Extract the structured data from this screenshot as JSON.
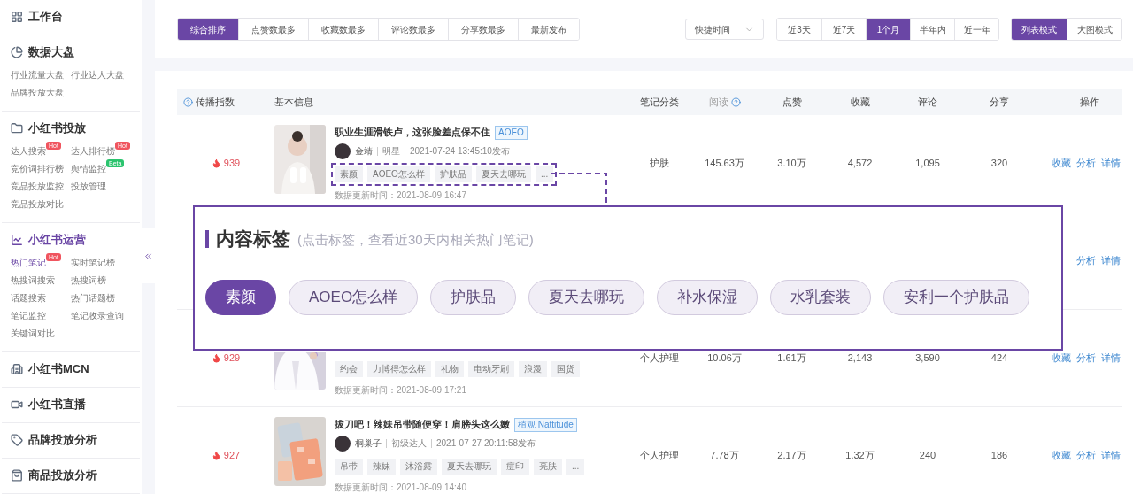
{
  "sidebar": {
    "sections": [
      {
        "title": "工作台",
        "selected": false
      },
      {
        "title": "数据大盘",
        "selected": false,
        "items": [
          {
            "label": "行业流量大盘",
            "selected": false
          },
          {
            "label": "行业达人大盘",
            "selected": false
          },
          {
            "label": "品牌投放大盘",
            "selected": false
          }
        ]
      },
      {
        "title": "小红书投放",
        "selected": false,
        "items": [
          {
            "label": "达人搜索",
            "selected": false,
            "badge": {
              "text": "Hot",
              "color": "#f0555f"
            }
          },
          {
            "label": "达人排行榜",
            "selected": false,
            "badge": {
              "text": "Hot",
              "color": "#f0555f"
            }
          },
          {
            "label": "竞价词排行榜",
            "selected": false
          },
          {
            "label": "舆情监控",
            "selected": false,
            "badge": {
              "text": "Beta",
              "color": "#2bc46e"
            }
          },
          {
            "label": "竞品投放监控",
            "selected": false
          },
          {
            "label": "投放管理",
            "selected": false
          },
          {
            "label": "竞品投放对比",
            "selected": false
          }
        ]
      },
      {
        "title": "小红书运营",
        "selected": true,
        "items": [
          {
            "label": "热门笔记",
            "selected": true,
            "badge": {
              "text": "Hot",
              "color": "#f0555f"
            }
          },
          {
            "label": "实时笔记榜",
            "selected": false
          },
          {
            "label": "热搜词搜索",
            "selected": false
          },
          {
            "label": "热搜词榜",
            "selected": false
          },
          {
            "label": "话题搜索",
            "selected": false
          },
          {
            "label": "热门话题榜",
            "selected": false
          },
          {
            "label": "笔记监控",
            "selected": false
          },
          {
            "label": "笔记收录查询",
            "selected": false
          },
          {
            "label": "关键词对比",
            "selected": false
          }
        ]
      },
      {
        "title": "小红书MCN",
        "selected": false
      },
      {
        "title": "小红书直播",
        "selected": false
      },
      {
        "title": "品牌投放分析",
        "selected": false
      },
      {
        "title": "商品投放分析",
        "selected": false
      }
    ]
  },
  "sort_tabs": [
    {
      "label": "综合排序",
      "selected": true
    },
    {
      "label": "点赞数最多",
      "selected": false
    },
    {
      "label": "收藏数最多",
      "selected": false
    },
    {
      "label": "评论数最多",
      "selected": false
    },
    {
      "label": "分享数最多",
      "selected": false
    },
    {
      "label": "最新发布",
      "selected": false
    }
  ],
  "time_select": {
    "placeholder": "快捷时间"
  },
  "period_tabs": [
    {
      "label": "近3天",
      "selected": false
    },
    {
      "label": "近7天",
      "selected": false
    },
    {
      "label": "1个月",
      "selected": true
    },
    {
      "label": "半年内",
      "selected": false
    },
    {
      "label": "近一年",
      "selected": false
    }
  ],
  "view_tabs": [
    {
      "label": "列表模式",
      "selected": true
    },
    {
      "label": "大图模式",
      "selected": false
    }
  ],
  "table": {
    "columns": [
      {
        "label": "传播指数",
        "help": true,
        "muted": false
      },
      {
        "label": "基本信息",
        "help": false,
        "muted": false
      },
      {
        "label": "笔记分类",
        "help": false,
        "muted": false
      },
      {
        "label": "阅读",
        "help": true,
        "muted": true
      },
      {
        "label": "点赞",
        "help": false,
        "muted": false
      },
      {
        "label": "收藏",
        "help": false,
        "muted": false
      },
      {
        "label": "评论",
        "help": false,
        "muted": false
      },
      {
        "label": "分享",
        "help": false,
        "muted": false
      },
      {
        "label": "操作",
        "help": false,
        "muted": false
      }
    ],
    "rows": [
      {
        "score": "939",
        "thumbnail": {
          "kind": "picture"
        },
        "title": "职业生涯滑铁卢，这张脸差点保不住",
        "brand": "AOEO",
        "author": "金靖",
        "role": "明星",
        "date": "2021-07-24 13:45:10发布",
        "tags_highlighted": true,
        "tags": [
          "素颜",
          "AOEO怎么样",
          "护肤品",
          "夏天去哪玩",
          "..."
        ],
        "updated": "数据更新时间：2021-08-09 16:47",
        "category": "护肤",
        "stats": [
          "145.63万",
          "3.10万",
          "4,572",
          "1,095",
          "320"
        ],
        "actions": [
          "收藏",
          "分析",
          "详情"
        ]
      },
      {
        "tags": [],
        "stats": [],
        "actions": [
          "分析",
          "详情"
        ]
      },
      {
        "score": "929",
        "thumbnail": {
          "kind": "picture"
        },
        "tags_highlighted": false,
        "tags": [
          "约会",
          "力博得怎么样",
          "礼物",
          "电动牙刷",
          "浪漫",
          "国货"
        ],
        "updated": "数据更新时间：2021-08-09 17:21",
        "category": "个人护理",
        "stats": [
          "10.06万",
          "1.61万",
          "2,143",
          "3,590",
          "424"
        ],
        "actions": [
          "收藏",
          "分析",
          "详情"
        ]
      },
      {
        "score": "927",
        "thumbnail": {
          "kind": "picture"
        },
        "title": "拔刀吧！辣妹吊带随便穿！肩膀头这么嫩",
        "brand": "植观 Nattitude",
        "author": "桐巢子",
        "role": "初级达人",
        "date": "2021-07-27 20:11:58发布",
        "tags_highlighted": false,
        "tags": [
          "吊带",
          "辣妹",
          "沐浴露",
          "夏天去哪玩",
          "痘印",
          "亮肤",
          "..."
        ],
        "updated": "数据更新时间：2021-08-09 14:40",
        "category": "个人护理",
        "stats": [
          "7.78万",
          "2.17万",
          "1.32万",
          "240",
          "186"
        ],
        "actions": [
          "收藏",
          "分析",
          "详情"
        ]
      }
    ]
  },
  "tag_popup": {
    "title": "内容标签",
    "hint": "(点击标签，查看近30天内相关热门笔记)",
    "tags": [
      {
        "label": "素颜",
        "selected": true
      },
      {
        "label": "AOEO怎么样",
        "selected": false
      },
      {
        "label": "护肤品",
        "selected": false
      },
      {
        "label": "夏天去哪玩",
        "selected": false
      },
      {
        "label": "补水保湿",
        "selected": false
      },
      {
        "label": "水乳套装",
        "selected": false
      },
      {
        "label": "安利一个护肤品",
        "selected": false
      }
    ]
  }
}
